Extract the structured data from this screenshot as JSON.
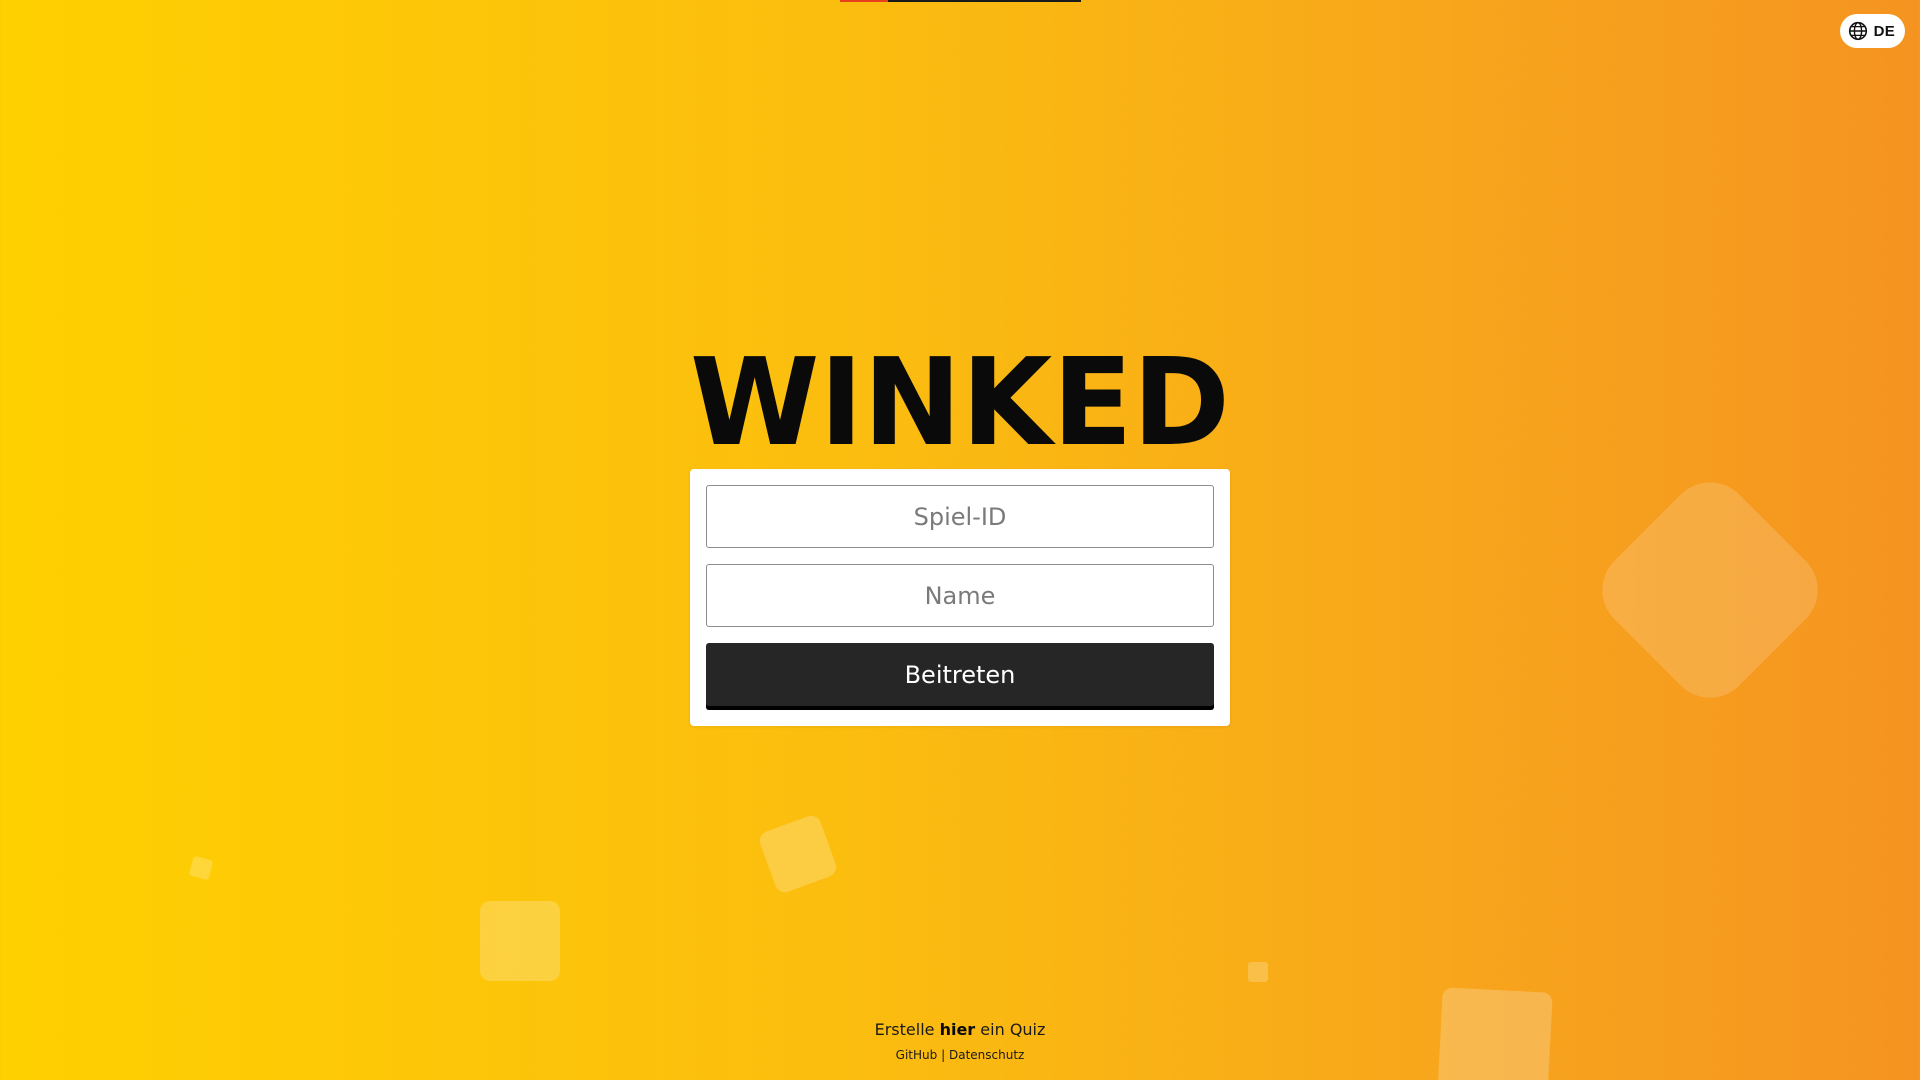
{
  "loading_bar": {
    "progress_fraction": 0.2,
    "fill_color": "#e8401c",
    "track_color": "#1a1a1a"
  },
  "language": {
    "icon": "globe-icon",
    "code": "DE"
  },
  "logo": {
    "text": "WINKED"
  },
  "join_form": {
    "game_id_placeholder": "Spiel-ID",
    "game_id_value": "",
    "name_placeholder": "Name",
    "name_value": "",
    "submit_label": "Beitreten"
  },
  "footer": {
    "create_prefix": "Erstelle",
    "create_link": "hier",
    "create_suffix": "ein Quiz",
    "github_link": "GitHub",
    "separator": "|",
    "privacy_link": "Datenschutz"
  },
  "colors": {
    "background_start": "#FFD000",
    "background_end": "#F59420",
    "button": "#262626",
    "card": "#ffffff"
  }
}
